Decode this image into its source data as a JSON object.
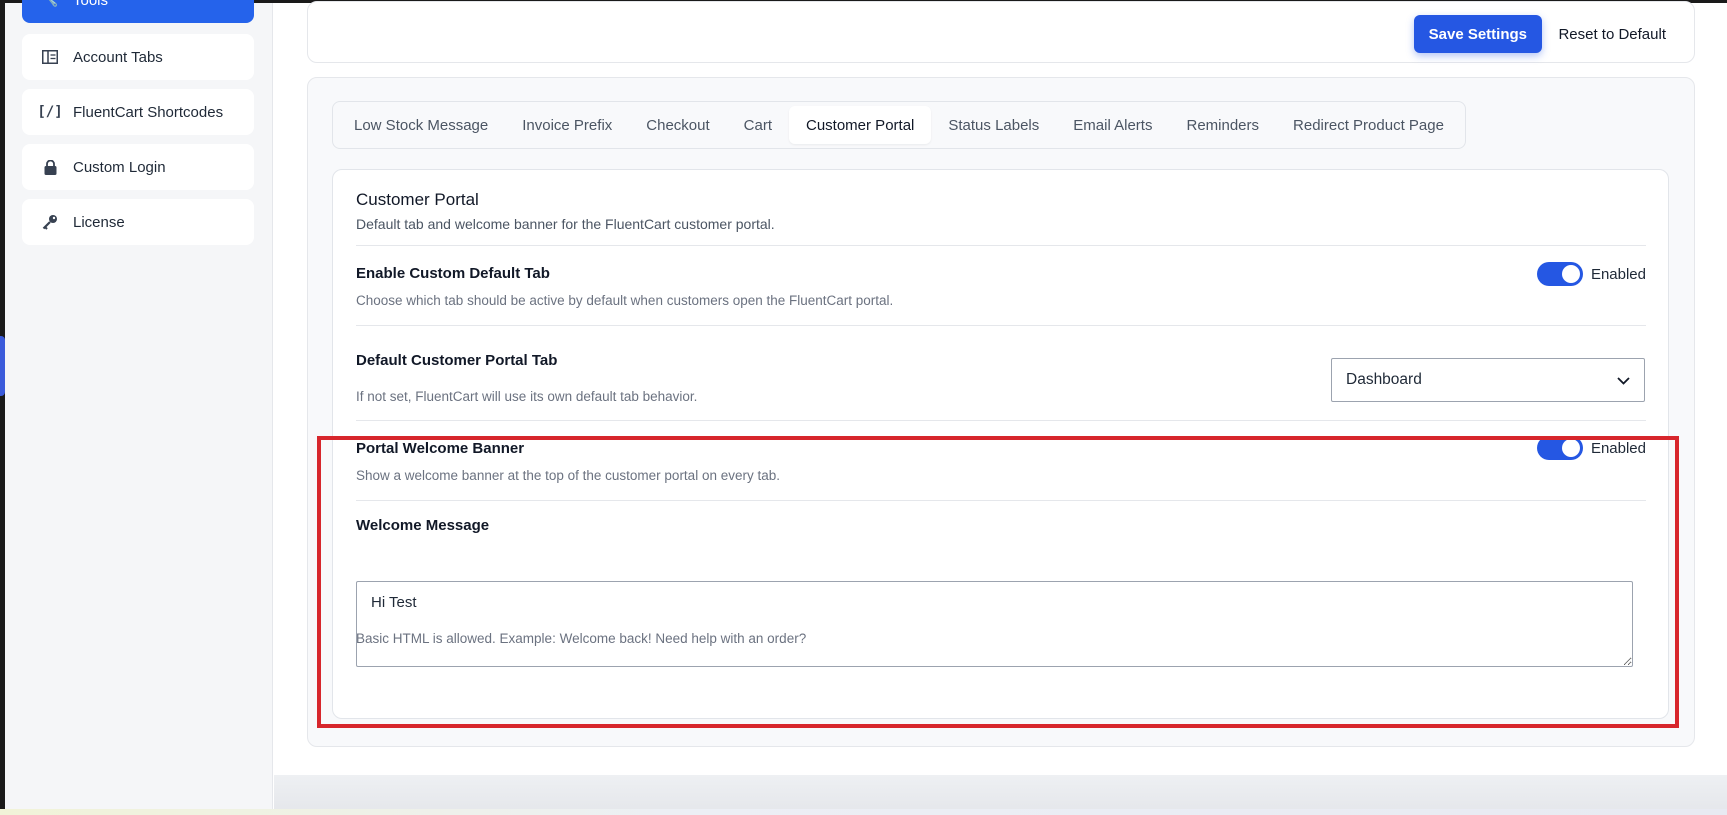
{
  "sidebar": {
    "active_item": {
      "label": "Tools",
      "icon": "wrench-icon"
    },
    "items": [
      {
        "label": "Account Tabs",
        "icon": "columns-icon"
      },
      {
        "label": "FluentCart Shortcodes",
        "icon": "shortcode-brackets-icon",
        "glyph": "[/]"
      },
      {
        "label": "Custom Login",
        "icon": "lock-icon"
      },
      {
        "label": "License",
        "icon": "key-icon"
      }
    ]
  },
  "toolbar": {
    "save_label": "Save Settings",
    "reset_label": "Reset to Default"
  },
  "tabs": [
    {
      "label": "Low Stock Message",
      "active": false
    },
    {
      "label": "Invoice Prefix",
      "active": false
    },
    {
      "label": "Checkout",
      "active": false
    },
    {
      "label": "Cart",
      "active": false
    },
    {
      "label": "Customer Portal",
      "active": true
    },
    {
      "label": "Status Labels",
      "active": false
    },
    {
      "label": "Email Alerts",
      "active": false
    },
    {
      "label": "Reminders",
      "active": false
    },
    {
      "label": "Redirect Product Page",
      "active": false
    }
  ],
  "card": {
    "title": "Customer Portal",
    "description": "Default tab and welcome banner for the FluentCart customer portal.",
    "enable_default_tab": {
      "label": "Enable Custom Default Tab",
      "help": "Choose which tab should be active by default when customers open the FluentCart portal.",
      "toggle_label": "Enabled",
      "enabled": true
    },
    "default_tab": {
      "label": "Default Customer Portal Tab",
      "help": "If not set, FluentCart will use its own default tab behavior.",
      "selected": "Dashboard"
    },
    "welcome_banner": {
      "label": "Portal Welcome Banner",
      "help": "Show a welcome banner at the top of the customer portal on every tab.",
      "toggle_label": "Enabled",
      "enabled": true
    },
    "welcome_message": {
      "label": "Welcome Message",
      "value": "Hi Test",
      "help": "Basic HTML is allowed. Example: Welcome back! Need help with an order?"
    }
  },
  "colors": {
    "accent": "#2557e3",
    "highlight": "#d7262c"
  }
}
